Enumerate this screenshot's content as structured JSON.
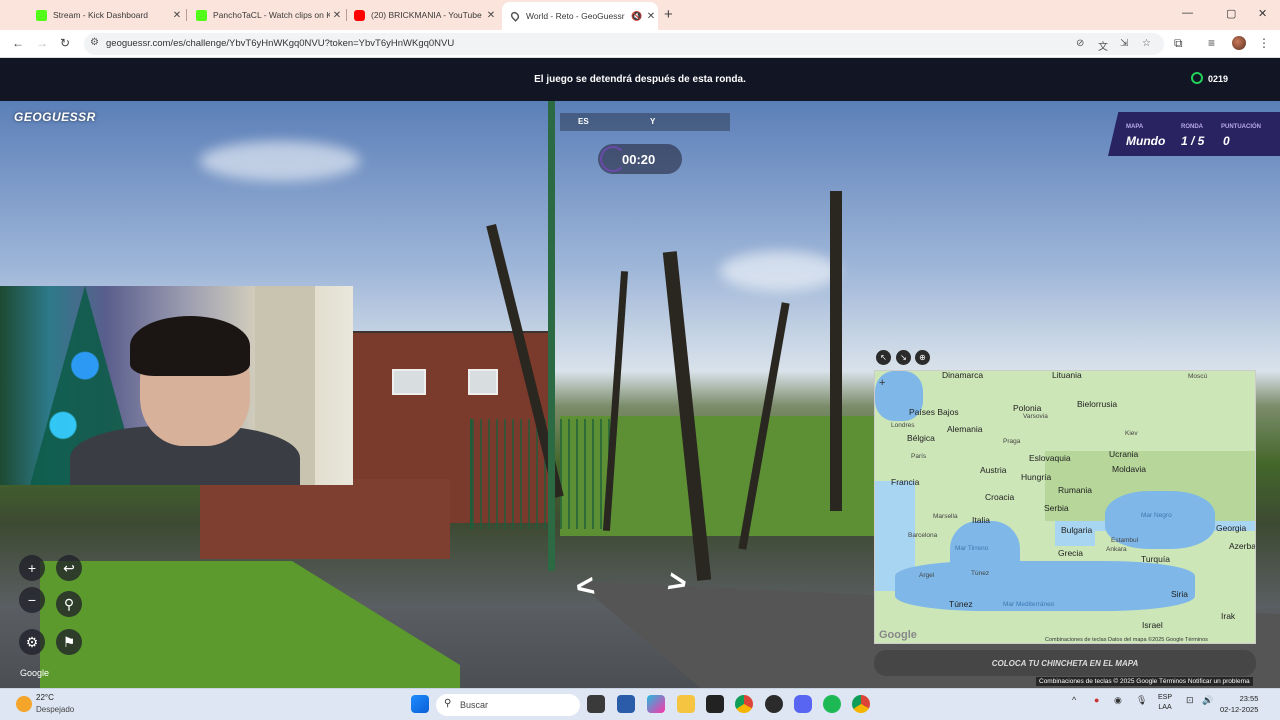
{
  "browser": {
    "tabs": [
      {
        "title": "Stream - Kick Dashboard",
        "favicon": "kick-icon"
      },
      {
        "title": "PanchoTaCL - Watch clips on K",
        "favicon": "kick-icon"
      },
      {
        "title": "(20) BRICKMANIA - YouTube",
        "favicon": "youtube-icon"
      },
      {
        "title": "World - Reto - GeoGuessr",
        "favicon": "geoguessr-pin-icon"
      }
    ],
    "url": "geoguessr.com/es/challenge/YbvT6yHnWKgq0NVU?token=YbvT6yHnWKgq0NVU"
  },
  "game": {
    "banner": "El juego se detendrá después de esta ronda.",
    "timer_counter": "0219",
    "logo": "GEOGUESSR",
    "compass": {
      "left": "ES",
      "right": "Y"
    },
    "countdown": "00:20",
    "status": {
      "map_label": "MAPA",
      "map_value": "Mundo",
      "round_label": "RONDA",
      "round_value": "1 / 5",
      "score_label": "PUNTUACIÓN",
      "score_value": "0"
    },
    "guess_button": "COLOCA TU CHINCHETA EN EL MAPA",
    "google_label": "Google",
    "footer": "Combinaciones de teclas  © 2025 Google  Términos  Notificar un problema"
  },
  "map": {
    "labels": {
      "dinamarca": "Dinamarca",
      "lituania": "Lituania",
      "moscu": "Moscú",
      "paises_bajos": "Países Bajos",
      "polonia": "Polonia",
      "varsovia": "Varsovia",
      "bielorrusia": "Bielorrusia",
      "londres": "Londres",
      "belgica": "Bélgica",
      "alemania": "Alemania",
      "praga": "Praga",
      "kiev": "Kiev",
      "ucrania": "Ucrania",
      "paris": "París",
      "eslovaquia": "Eslovaquia",
      "austria": "Austria",
      "moldavia": "Moldavia",
      "francia": "Francia",
      "hungria": "Hungría",
      "croacia": "Croacia",
      "rumania": "Rumania",
      "serbia": "Serbia",
      "marsella": "Marsella",
      "italia": "Italia",
      "mar_negro": "Mar Negro",
      "georgia": "Georgia",
      "barcelona": "Barcelona",
      "bulgaria": "Bulgaria",
      "estambul": "Estambul",
      "mar_tirreno": "Mar Tirreno",
      "grecia": "Grecia",
      "ankara": "Ankara",
      "turquia": "Turquía",
      "azerbaiyan": "Azerba",
      "argel": "Argel",
      "tunez_city": "Túnez",
      "tunez": "Túnez",
      "mar_mediterraneo": "Mar Mediterráneo",
      "siria": "Siria",
      "irak": "Irak",
      "israel": "Israel",
      "google": "Google",
      "attribution": "Combinaciones de teclas   Datos del mapa ©2025 Google   Términos"
    }
  },
  "taskbar": {
    "temp": "22°C",
    "weather": "Despejado",
    "search_placeholder": "Buscar",
    "lang_top": "ESP",
    "lang_bottom": "LAA",
    "time": "23:55",
    "date": "02-12-2025"
  }
}
